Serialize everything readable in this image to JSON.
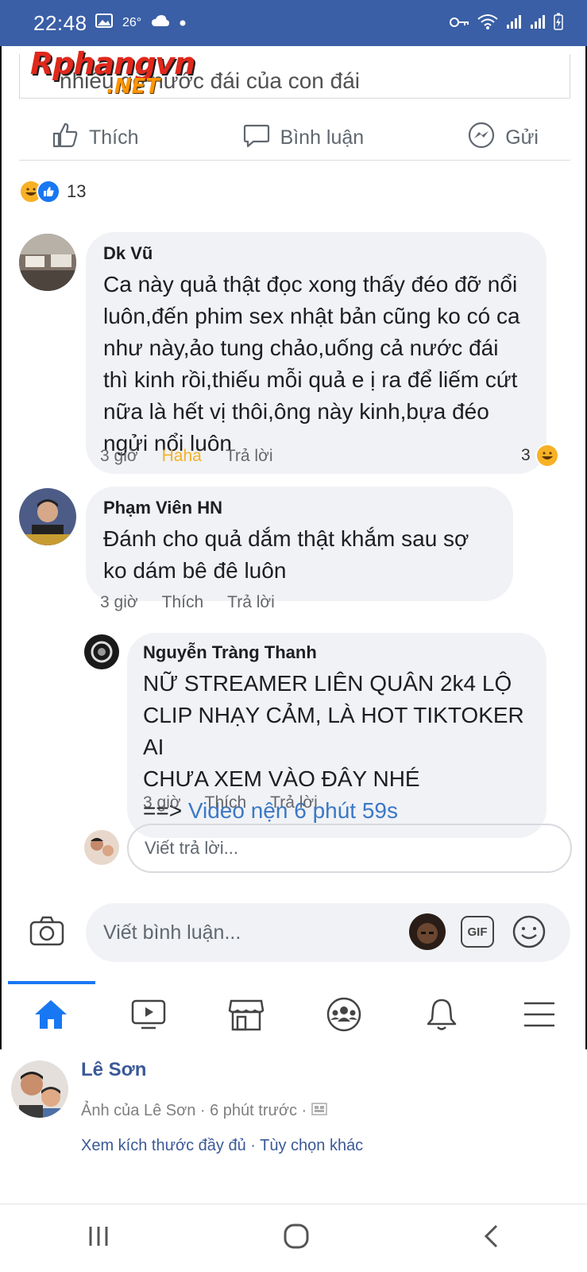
{
  "status_bar": {
    "time": "22:48",
    "temperature": "26°"
  },
  "watermark": {
    "top": "Rphangvn",
    "bottom": ".NET"
  },
  "post": {
    "partial_text": "nhiều gò nước đái của con đái"
  },
  "actions": {
    "like": "Thích",
    "comment": "Bình luận",
    "send": "Gửi"
  },
  "reactions": {
    "count": "13"
  },
  "comments": [
    {
      "name": "Dk Vũ",
      "text": "Ca này quả thật đọc xong thấy đéo đỡ nổi luôn,đến phim sex nhật bản cũng ko có ca như này,ảo tung chảo,uống cả nước đái thì kinh rồi,thiếu mỗi quả e ị ra để liếm cứt nữa là hết vị thôi,ông này kinh,bựa đéo ngửi nổi luôn",
      "time": "3 giờ",
      "reaction_label": "Haha",
      "reply_label": "Trả lời",
      "reaction_count": "3"
    },
    {
      "name": "Phạm Viên HN",
      "text": "Đánh cho quả dắm thật khắm sau sợ ko dám bê đê luôn",
      "time": "3 giờ",
      "like_label": "Thích",
      "reply_label": "Trả lời"
    },
    {
      "name": "Nguyễn Tràng Thanh",
      "text_lines": [
        "NỮ STREAMER LIÊN QUÂN 2k4 LỘ",
        "CLIP NHẠY CẢM, LÀ HOT TIKTOKER AI",
        "CHƯA XEM VÀO ĐÂY NHÉ"
      ],
      "arrow": "==>",
      "link_text": "Video nện 6 phút 59s",
      "time": "3 giờ",
      "like_label": "Thích",
      "reply_label": "Trả lời"
    }
  ],
  "reply_input": {
    "placeholder": "Viết trả lời..."
  },
  "comment_input": {
    "placeholder": "Viết bình luận...",
    "gif_label": "GIF"
  },
  "caption": {
    "author": "Lê Sơn",
    "subtitle": "Ảnh của Lê Sơn · 6 phút trước ·",
    "links": "Xem kích thước đầy đủ · Tùy chọn khác"
  },
  "colors": {
    "status_bar": "#3a5fa6",
    "fb_blue": "#1877f2",
    "link": "#3b5998",
    "haha": "#f7b125"
  }
}
